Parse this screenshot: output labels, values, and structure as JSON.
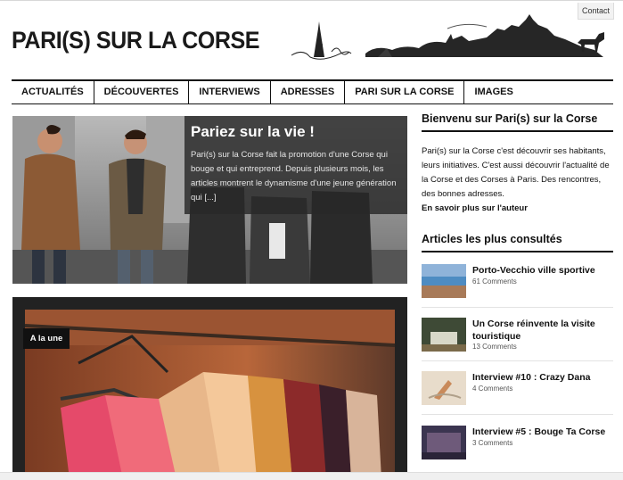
{
  "header": {
    "contact_label": "Contact",
    "logo_text": "PARI(S) SUR LA CORSE"
  },
  "nav": {
    "items": [
      "ACTUALITÉS",
      "DÉCOUVERTES",
      "INTERVIEWS",
      "ADRESSES",
      "PARI SUR LA CORSE",
      "IMAGES"
    ]
  },
  "hero": {
    "title": "Pariez sur la vie !",
    "excerpt": "Pari(s) sur la Corse fait la promotion d'une Corse qui bouge et qui entreprend. Depuis plusieurs mois, les articles montrent le dynamisme d'une jeune génération qui [...]"
  },
  "feature": {
    "badge": "A la une"
  },
  "sidebar": {
    "welcome_heading": "Bienvenu sur Pari(s) sur la Corse",
    "welcome_text": "Pari(s) sur la Corse c'est découvrir ses habitants, leurs initiatives. C'est aussi découvrir l'actualité de la Corse et des Corses à Paris. Des rencontres, des bonnes adresses.",
    "author_link": "En savoir plus sur l'auteur",
    "popular_heading": "Articles les plus consultés",
    "posts": [
      {
        "title": "Porto-Vecchio ville sportive",
        "comments": "61 Comments"
      },
      {
        "title": "Un Corse réinvente la visite touristique",
        "comments": "13 Comments"
      },
      {
        "title": "Interview #10 : Crazy Dana",
        "comments": "4 Comments"
      },
      {
        "title": "Interview #5 : Bouge Ta Corse",
        "comments": "3 Comments"
      }
    ]
  },
  "colors": {
    "accent": "#111111",
    "panel": "#282828"
  }
}
